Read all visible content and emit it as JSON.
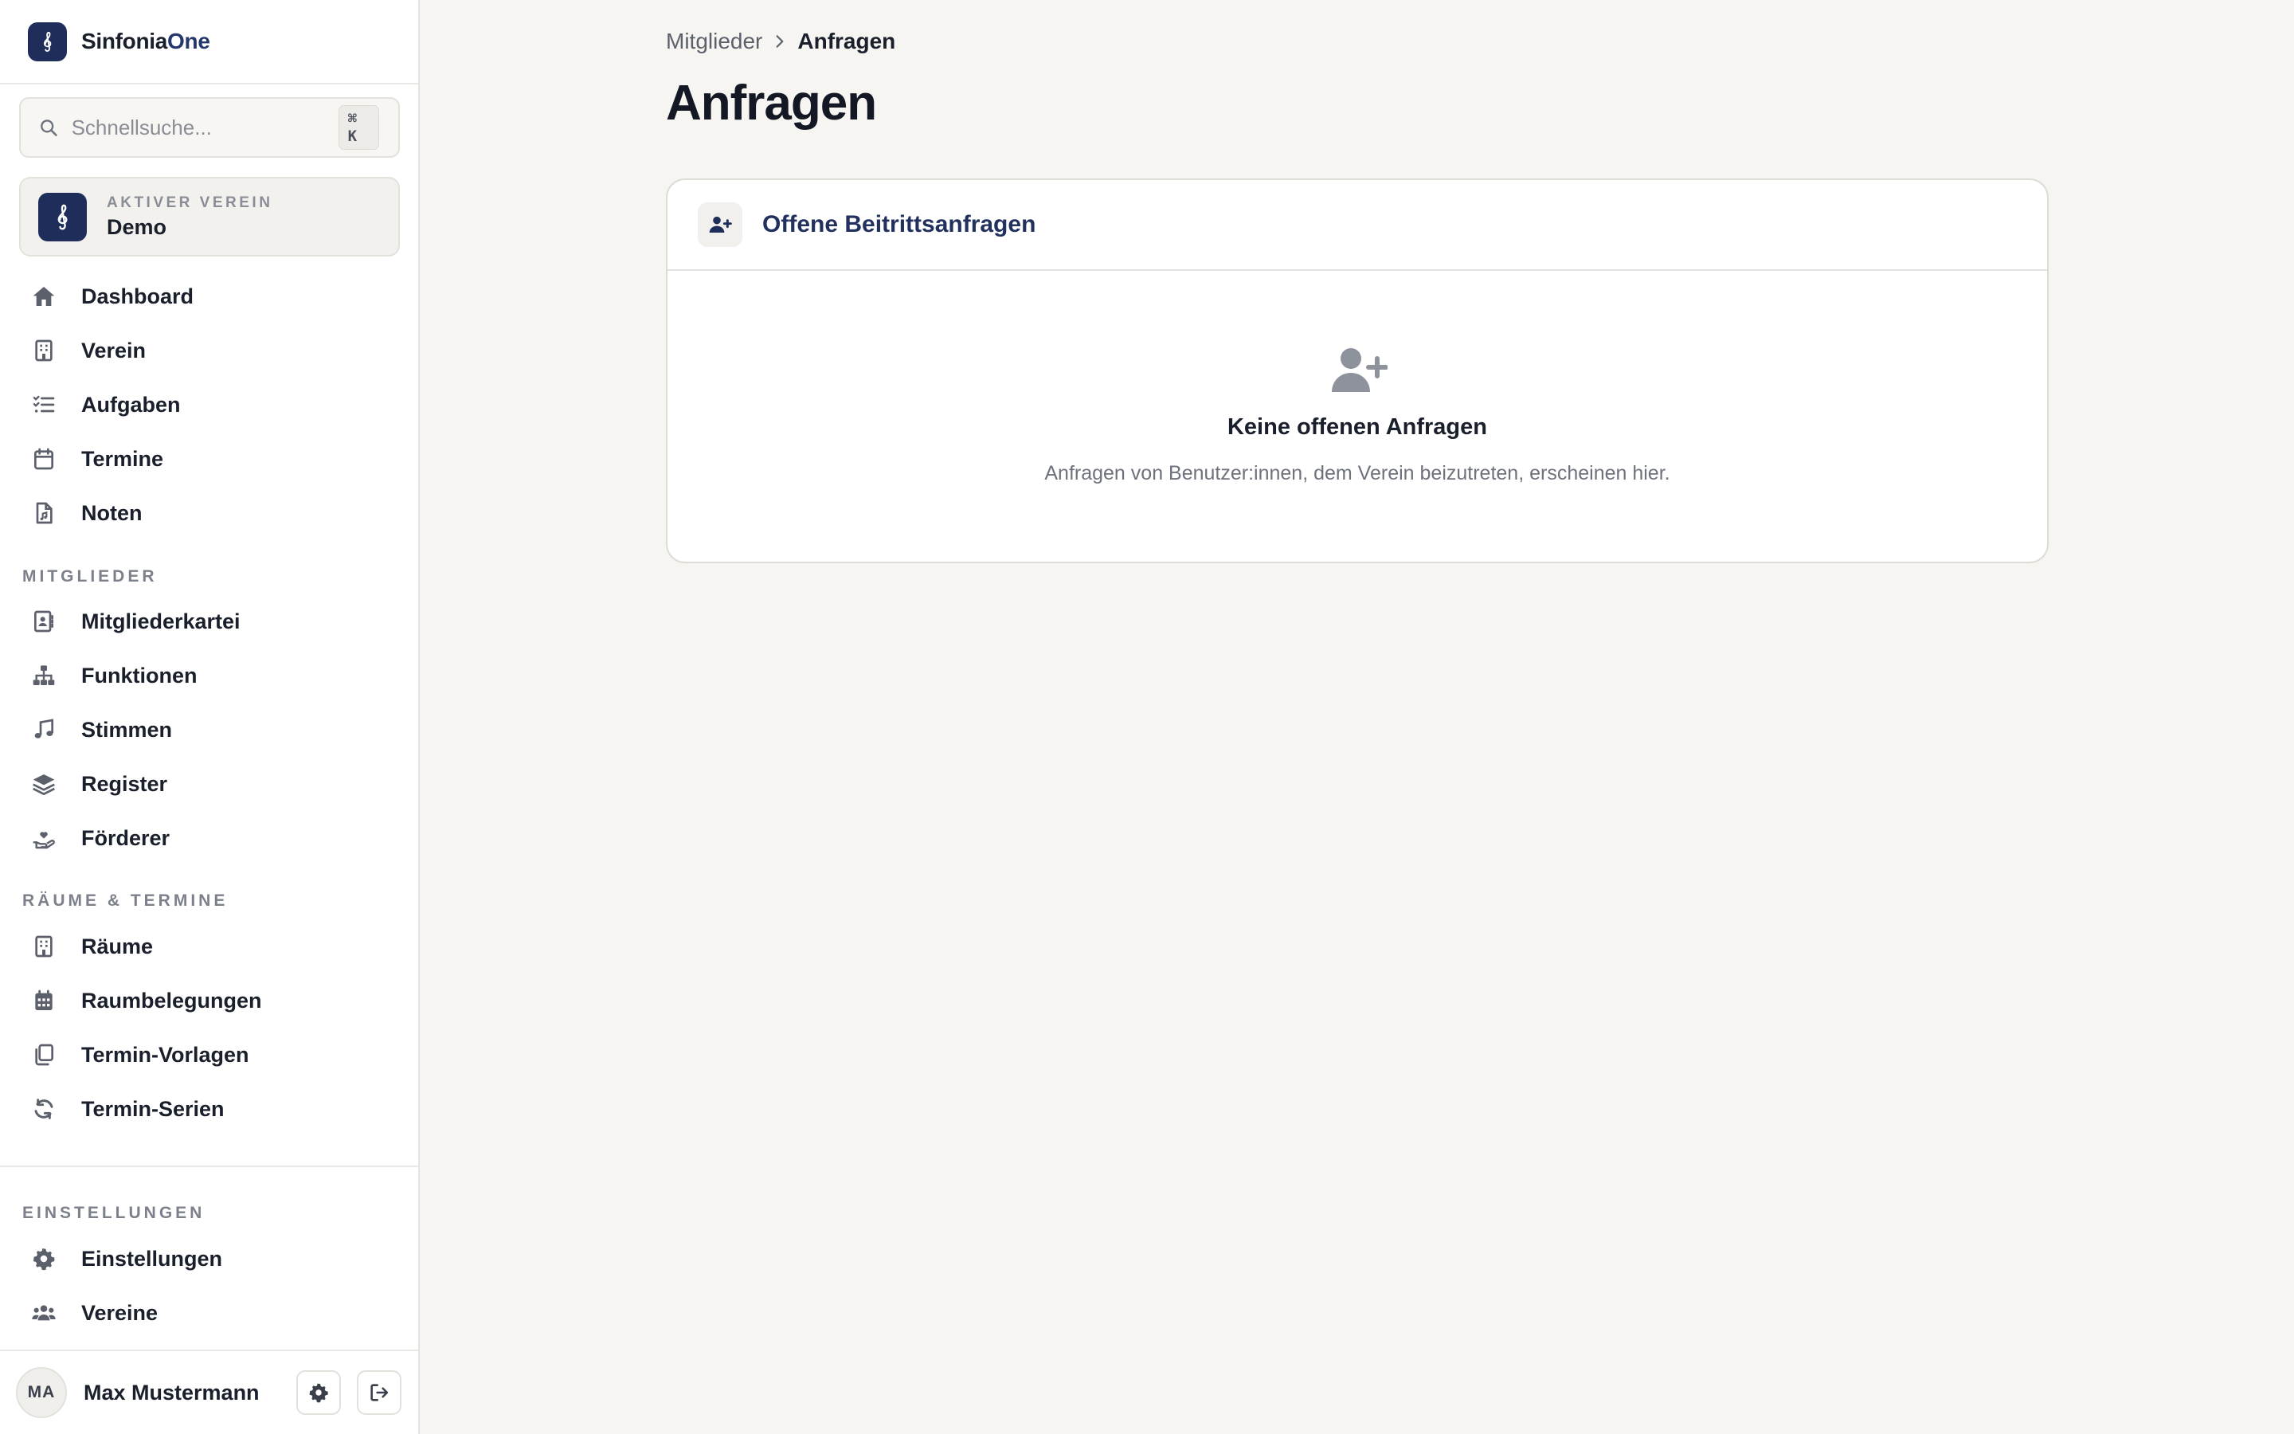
{
  "brand": {
    "name_part1": "Sinfonia",
    "name_part2": "One"
  },
  "search": {
    "placeholder": "Schnellsuche...",
    "shortcut": "⌘ K"
  },
  "active_club": {
    "caption": "AKTIVER VEREIN",
    "name": "Demo"
  },
  "nav": {
    "main": [
      {
        "label": "Dashboard",
        "icon": "home-icon"
      },
      {
        "label": "Verein",
        "icon": "building-icon"
      },
      {
        "label": "Aufgaben",
        "icon": "list-check-icon"
      },
      {
        "label": "Termine",
        "icon": "calendar-icon"
      },
      {
        "label": "Noten",
        "icon": "sheet-music-file-icon"
      }
    ],
    "members_heading": "MITGLIEDER",
    "members": [
      {
        "label": "Mitgliederkartei",
        "icon": "address-book-icon"
      },
      {
        "label": "Funktionen",
        "icon": "sitemap-icon"
      },
      {
        "label": "Stimmen",
        "icon": "music-note-icon"
      },
      {
        "label": "Register",
        "icon": "layers-icon"
      },
      {
        "label": "Förderer",
        "icon": "hand-heart-icon"
      }
    ],
    "rooms_heading": "RÄUME & TERMINE",
    "rooms": [
      {
        "label": "Räume",
        "icon": "building-icon"
      },
      {
        "label": "Raumbelegungen",
        "icon": "calendar-grid-icon"
      },
      {
        "label": "Termin-Vorlagen",
        "icon": "copy-icon"
      },
      {
        "label": "Termin-Serien",
        "icon": "refresh-icon"
      }
    ],
    "settings_heading": "EINSTELLUNGEN",
    "settings": [
      {
        "label": "Einstellungen",
        "icon": "gear-icon"
      },
      {
        "label": "Vereine",
        "icon": "users-icon"
      }
    ]
  },
  "user": {
    "initials": "MA",
    "name": "Max Mustermann"
  },
  "breadcrumb": {
    "parent": "Mitglieder",
    "current": "Anfragen"
  },
  "page": {
    "title": "Anfragen"
  },
  "panel": {
    "title": "Offene Beitrittsanfragen",
    "empty_title": "Keine offenen Anfragen",
    "empty_description": "Anfragen von Benutzer:innen, dem Verein beizutreten, erscheinen hier."
  },
  "colors": {
    "brand_navy": "#1e2d5a",
    "panel_title": "#22305e",
    "background": "#f6f5f2",
    "icon_gray": "#8e929b"
  }
}
